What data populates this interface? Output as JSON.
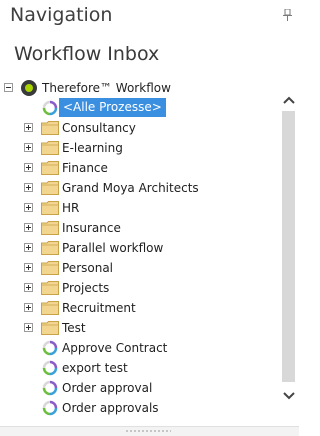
{
  "panel": {
    "title": "Navigation",
    "pin_icon": "pin-icon"
  },
  "inbox": {
    "title": "Workflow Inbox"
  },
  "tree": {
    "root": {
      "label": "Therefore™ Workflow",
      "icon": "therefore-logo-icon"
    },
    "selected": {
      "label": "<Alle Prozesse>",
      "icon": "workflow-process-icon"
    },
    "folders": [
      {
        "label": "Consultancy"
      },
      {
        "label": "E-learning"
      },
      {
        "label": "Finance"
      },
      {
        "label": "Grand Moya Architects"
      },
      {
        "label": "HR"
      },
      {
        "label": "Insurance"
      },
      {
        "label": "Parallel workflow"
      },
      {
        "label": "Personal"
      },
      {
        "label": "Projects"
      },
      {
        "label": "Recruitment"
      },
      {
        "label": "Test"
      }
    ],
    "processes": [
      {
        "label": "Approve Contract"
      },
      {
        "label": "export test"
      },
      {
        "label": "Order approval"
      },
      {
        "label": "Order approvals"
      }
    ]
  },
  "colors": {
    "selection": "#3b8fe0",
    "folder": "#f2d58e",
    "folder_outline": "#c9a24a"
  }
}
